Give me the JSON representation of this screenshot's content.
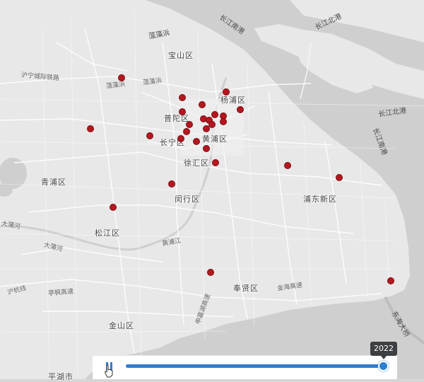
{
  "districts": [
    {
      "name": "宝山区"
    },
    {
      "name": "杨浦区"
    },
    {
      "name": "普陀区"
    },
    {
      "name": "长宁区"
    },
    {
      "name": "黄浦区"
    },
    {
      "name": "徐汇区"
    },
    {
      "name": "青浦区"
    },
    {
      "name": "闵行区"
    },
    {
      "name": "浦东新区"
    },
    {
      "name": "松江区"
    },
    {
      "name": "奉贤区"
    },
    {
      "name": "金山区"
    },
    {
      "name": "平湖市"
    }
  ],
  "roads": [
    "沪宁城际铁路",
    "蕰藻浜",
    "蕰藻浜",
    "大蒲河",
    "大蒲河",
    "黄浦江",
    "沪杭线",
    "亭枫高速",
    "金海高速",
    "申嘉湖高速"
  ],
  "water_labels": [
    "长江南港",
    "长江北港",
    "长江北港",
    "长江南港",
    "东海大桥",
    "蕰藻浜"
  ],
  "colors": {
    "dot": "#b5171f",
    "slider": "#2e7fd1",
    "land": "#e9e9e9",
    "water": "#cccccc"
  },
  "timeline": {
    "year": "2022",
    "progress": 1.0,
    "state": "playing"
  }
}
